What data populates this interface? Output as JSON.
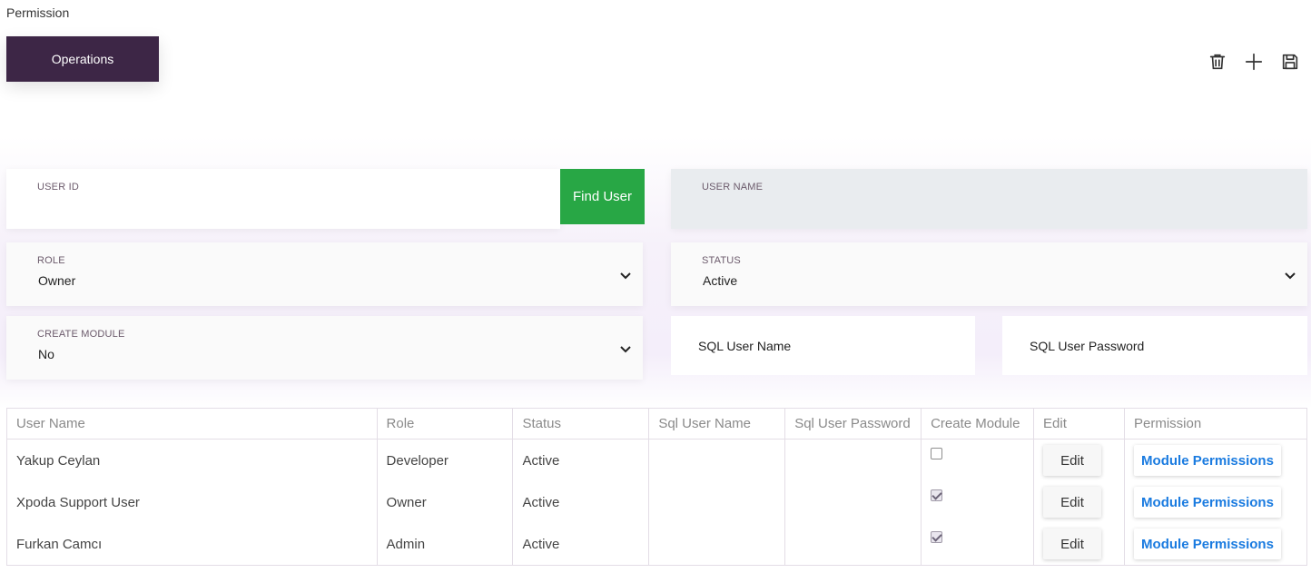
{
  "page": {
    "title": "Permission"
  },
  "tabs": {
    "operations": "Operations"
  },
  "form": {
    "user_id": {
      "label": "USER ID",
      "value": ""
    },
    "find_user": "Find User",
    "user_name": {
      "label": "USER NAME",
      "value": ""
    },
    "role": {
      "label": "ROLE",
      "value": "Owner"
    },
    "status": {
      "label": "STATUS",
      "value": "Active"
    },
    "create_module": {
      "label": "CREATE MODULE",
      "value": "No"
    },
    "sql_user_name": "SQL User Name",
    "sql_user_password": "SQL User Password"
  },
  "table": {
    "headers": [
      "User Name",
      "Role",
      "Status",
      "Sql User Name",
      "Sql User Password",
      "Create Module",
      "Edit",
      "Permission"
    ],
    "rows": [
      {
        "user_name": "Yakup Ceylan",
        "role": "Developer",
        "status": "Active",
        "sql_user_name": "",
        "sql_user_password": "",
        "create_module": false,
        "edit": "Edit",
        "permission": "Module Permissions"
      },
      {
        "user_name": "Xpoda Support User",
        "role": "Owner",
        "status": "Active",
        "sql_user_name": "",
        "sql_user_password": "",
        "create_module": true,
        "edit": "Edit",
        "permission": "Module Permissions"
      },
      {
        "user_name": "Furkan Camcı",
        "role": "Admin",
        "status": "Active",
        "sql_user_name": "",
        "sql_user_password": "",
        "create_module": true,
        "edit": "Edit",
        "permission": "Module Permissions"
      }
    ]
  },
  "colors": {
    "tab_bg": "#3d2646",
    "find_button": "#28a745",
    "link": "#1a7be0"
  }
}
